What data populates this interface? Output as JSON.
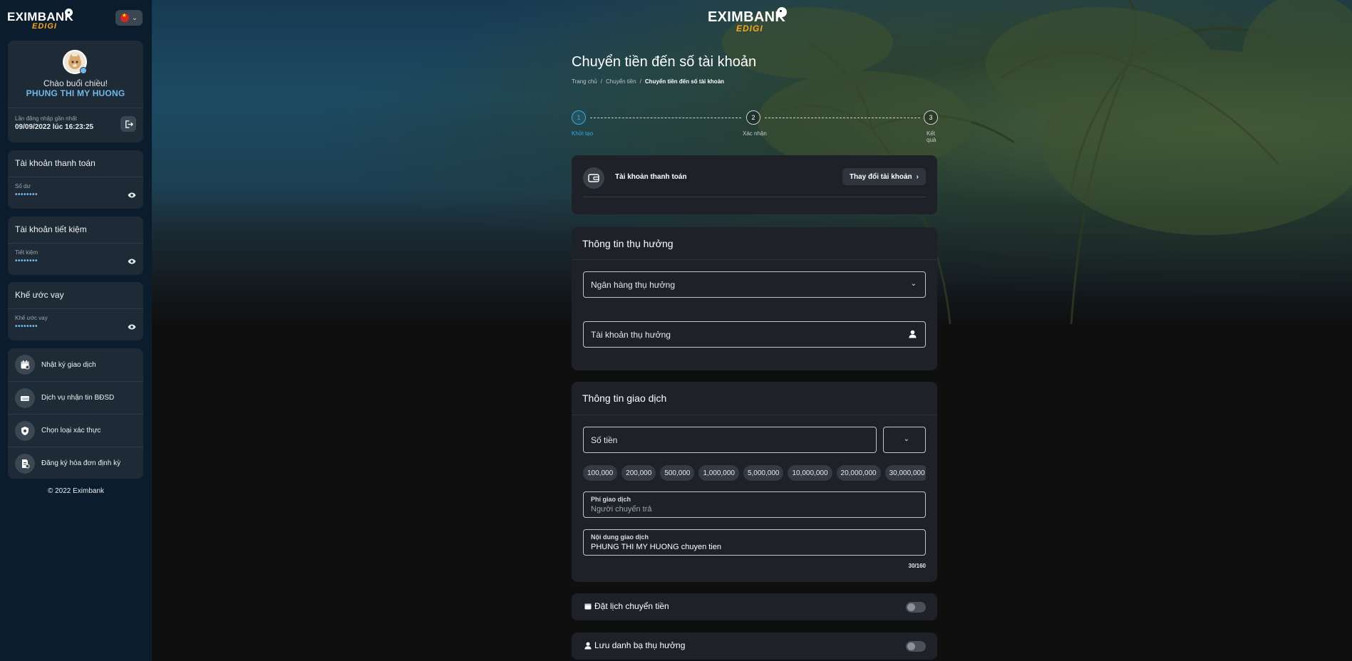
{
  "brand": {
    "name": "EXIMBANK",
    "sub": "EDIGI"
  },
  "profile": {
    "greeting": "Chào buổi chiều!",
    "name": "PHUNG THI MY HUONG",
    "last_login_label": "Lần đăng nhập gần nhất",
    "last_login_time": "09/09/2022 lúc 16:23:25"
  },
  "accounts": [
    {
      "title": "Tài khoản thanh toán",
      "label": "Số dư",
      "value": "••••••••"
    },
    {
      "title": "Tài khoản tiết kiệm",
      "label": "Tiết kiệm",
      "value": "••••••••"
    },
    {
      "title": "Khế ước vay",
      "label": "Khế ước vay",
      "value": "••••••••"
    }
  ],
  "menu": [
    {
      "label": "Nhật ký giao dịch",
      "icon": "calendar-icon"
    },
    {
      "label": "Dịch vụ nhận tin BĐSD",
      "icon": "sms-icon"
    },
    {
      "label": "Chọn loại xác thực",
      "icon": "shield-icon"
    },
    {
      "label": "Đăng ký hóa đơn định kỳ",
      "icon": "bill-icon"
    }
  ],
  "copyright": "© 2022 Eximbank",
  "page": {
    "title": "Chuyển tiền đến số tài khoản",
    "breadcrumb": [
      "Trang chủ",
      "Chuyển tiền",
      "Chuyển tiền đến số tài khoản"
    ]
  },
  "steps": [
    {
      "number": "1",
      "label": "Khởi tạo"
    },
    {
      "number": "2",
      "label": "Xác nhận"
    },
    {
      "number": "3",
      "label": "Kết quả"
    }
  ],
  "source_account": {
    "label": "Tài khoản thanh toán",
    "change_label": "Thay đổi tài khoản"
  },
  "beneficiary": {
    "title": "Thông tin thụ hưởng",
    "bank_placeholder": "Ngân hàng thụ hưởng",
    "account_placeholder": "Tài khoản thụ hưởng"
  },
  "transaction": {
    "title": "Thông tin giao dịch",
    "amount_placeholder": "Số tiền",
    "quick_amounts": [
      "100,000",
      "200,000",
      "500,000",
      "1,000,000",
      "5,000,000",
      "10,000,000",
      "20,000,000",
      "30,000,000"
    ],
    "fee_label": "Phí giao dịch",
    "fee_value": "Người chuyển trả",
    "content_label": "Nội dung giao dịch",
    "content_value": "PHUNG THI MY HUONG chuyen tien",
    "counter": "30/160"
  },
  "toggles": [
    {
      "label": "Đặt lịch chuyển tiền",
      "icon": "calendar-icon",
      "on": false
    },
    {
      "label": "Lưu danh bạ thụ hưởng",
      "icon": "person-icon",
      "on": false
    }
  ],
  "colors": {
    "accent": "#3ea6e0",
    "sidebar": "#0b1d2d",
    "panel": "#1e2228",
    "highlight": "#6fb8ea"
  }
}
